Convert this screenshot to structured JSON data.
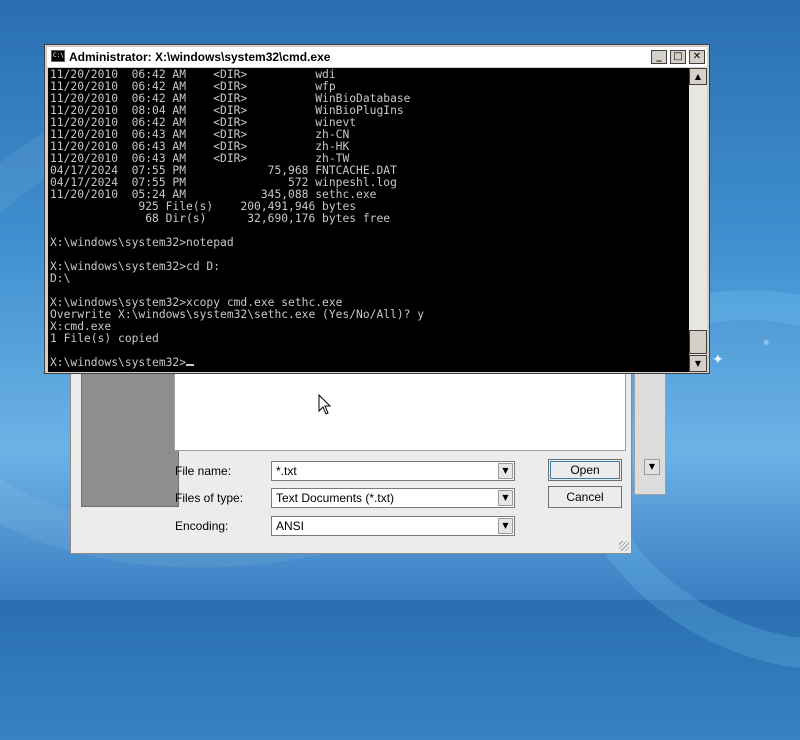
{
  "cmd": {
    "title": "Administrator: X:\\windows\\system32\\cmd.exe",
    "icon_label": "C:\\",
    "controls": {
      "minimize": "_",
      "maximize": "□",
      "close": "✕"
    },
    "lines": [
      "11/20/2010  06:42 AM    <DIR>          wdi",
      "11/20/2010  06:42 AM    <DIR>          wfp",
      "11/20/2010  06:42 AM    <DIR>          WinBioDatabase",
      "11/20/2010  08:04 AM    <DIR>          WinBioPlugIns",
      "11/20/2010  06:42 AM    <DIR>          winevt",
      "11/20/2010  06:43 AM    <DIR>          zh-CN",
      "11/20/2010  06:43 AM    <DIR>          zh-HK",
      "11/20/2010  06:43 AM    <DIR>          zh-TW",
      "04/17/2024  07:55 PM            75,968 FNTCACHE.DAT",
      "04/17/2024  07:55 PM               572 winpeshl.log",
      "11/20/2010  05:24 AM           345,088 sethc.exe",
      "             925 File(s)    200,491,946 bytes",
      "              68 Dir(s)      32,690,176 bytes free",
      "",
      "X:\\windows\\system32>notepad",
      "",
      "X:\\windows\\system32>cd D:",
      "D:\\",
      "",
      "X:\\windows\\system32>xcopy cmd.exe sethc.exe",
      "Overwrite X:\\windows\\system32\\sethc.exe (Yes/No/All)? y",
      "X:cmd.exe",
      "1 File(s) copied",
      ""
    ],
    "prompt": "X:\\windows\\system32>",
    "scroll": {
      "up": "▲",
      "down": "▼"
    }
  },
  "dialog": {
    "file_name_label": "File name:",
    "file_name_value": "*.txt",
    "file_type_label": "Files of type:",
    "file_type_value": "Text Documents (*.txt)",
    "encoding_label": "Encoding:",
    "encoding_value": "ANSI",
    "open_button": "Open",
    "cancel_button": "Cancel",
    "combo_arrow": "▼"
  },
  "colors": {
    "console_bg": "#000000",
    "console_fg": "#c8c8c8",
    "desktop": "#3f8fd0"
  }
}
